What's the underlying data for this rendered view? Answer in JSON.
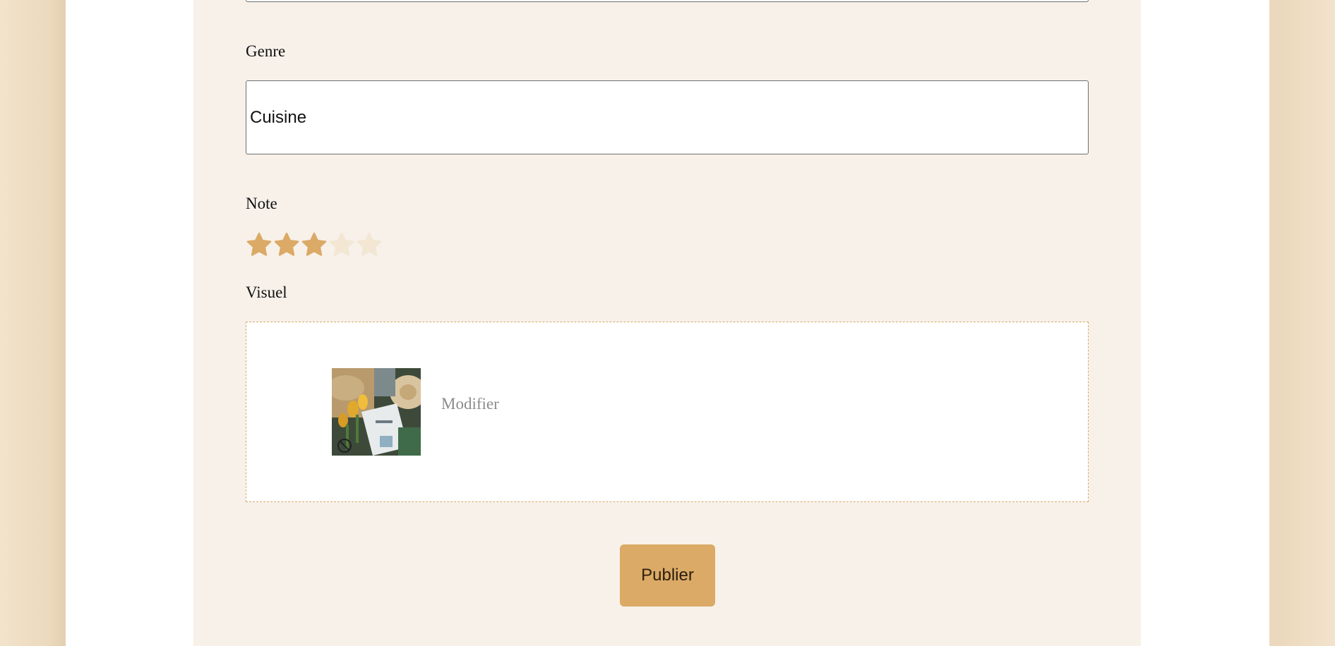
{
  "form": {
    "genre_label": "Genre",
    "genre_value": "Cuisine",
    "note_label": "Note",
    "rating": 3,
    "rating_max": 5,
    "visuel_label": "Visuel",
    "modify_label": "Modifier",
    "publish_label": "Publier"
  },
  "colors": {
    "star_filled": "#dbaa66",
    "star_empty": "#f3e6d3",
    "panel_background": "#f7f1ea",
    "outer_background": "#ecd9bd",
    "button": "#dbaa66",
    "dropzone_border": "#d9a866"
  },
  "icons": {
    "rating_star": "star-icon",
    "thumbnail": "cookbook-flatlay-photo"
  }
}
